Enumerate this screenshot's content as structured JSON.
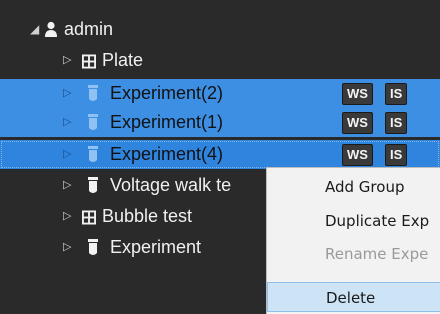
{
  "tree": {
    "root": {
      "label": "admin",
      "expanded": true
    },
    "items": [
      {
        "label": "Plate",
        "icon": "grid-icon",
        "state": "normal",
        "badges": []
      },
      {
        "label": "Experiment(2)",
        "icon": "tube-icon",
        "state": "selected",
        "badges": [
          "WS",
          "IS"
        ]
      },
      {
        "label": "Experiment(1)",
        "icon": "tube-icon",
        "state": "selected",
        "badges": [
          "WS",
          "IS"
        ]
      },
      {
        "label": "Experiment(4)",
        "icon": "tube-icon",
        "state": "focused",
        "badges": [
          "WS",
          "IS"
        ]
      },
      {
        "label": "Voltage walk te",
        "icon": "tube-icon",
        "state": "normal",
        "badges": []
      },
      {
        "label": "Bubble test",
        "icon": "grid-icon",
        "state": "normal",
        "badges": []
      },
      {
        "label": "Experiment",
        "icon": "tube-icon",
        "state": "normal",
        "badges": []
      }
    ]
  },
  "context_menu": {
    "items": [
      {
        "label": "Add Group",
        "enabled": true
      },
      {
        "label": "Duplicate Exp",
        "enabled": true
      },
      {
        "label": "Rename Expe",
        "enabled": false
      },
      {
        "label": "Delete",
        "enabled": true,
        "hovered": true
      }
    ]
  },
  "colors": {
    "background": "#2a2a2a",
    "selection": "#3d8fe3",
    "menu_background": "#f2f2f2",
    "menu_hover": "#cde4f7"
  }
}
